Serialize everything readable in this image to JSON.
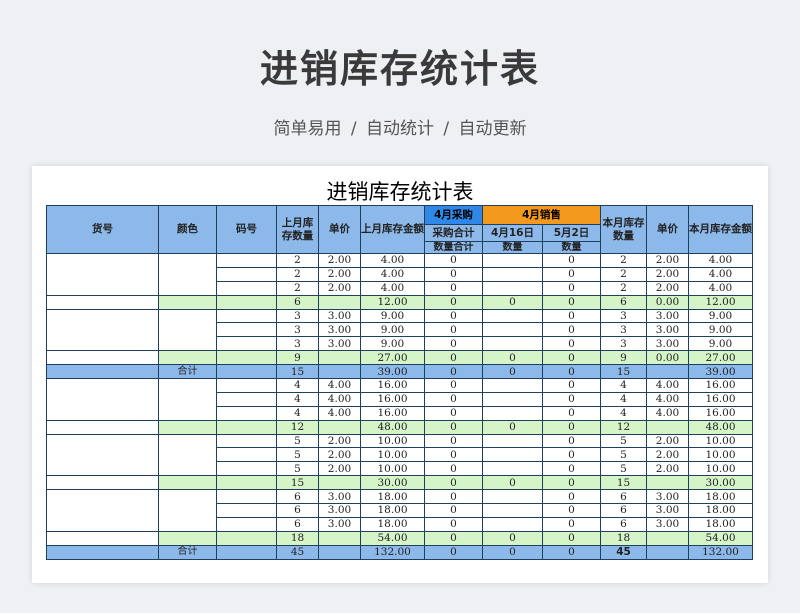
{
  "header": {
    "title": "进销库存统计表",
    "subtitle": "简单易用  /  自动统计  /  自动更新"
  },
  "sheet": {
    "title": "进销库存统计表",
    "columns": {
      "item_no": "货号",
      "color": "颜色",
      "code": "码号",
      "last_qty": "上月库存数量",
      "unit_price": "单价",
      "last_amount": "上月库存金额",
      "purchase_group": "4月采购",
      "sales_group": "4月销售",
      "purchase_total": "采购合计",
      "sale_date_1": "4月16日",
      "sale_date_2": "5月2日",
      "qty_total": "数量合计",
      "qty_1": "数量",
      "qty_2": "数量",
      "month_qty": "本月库存数量",
      "month_price": "单价",
      "month_amount": "本月库存金额"
    },
    "rows": [
      {
        "type": "item",
        "c": [
          "2",
          "2.00",
          "4.00",
          "0",
          "",
          "0",
          "2",
          "2.00",
          "4.00"
        ]
      },
      {
        "type": "item",
        "c": [
          "2",
          "2.00",
          "4.00",
          "0",
          "",
          "0",
          "2",
          "2.00",
          "4.00"
        ]
      },
      {
        "type": "item",
        "c": [
          "2",
          "2.00",
          "4.00",
          "0",
          "",
          "0",
          "2",
          "2.00",
          "4.00"
        ]
      },
      {
        "type": "subtotal",
        "c": [
          "6",
          "",
          "12.00",
          "0",
          "0",
          "0",
          "6",
          "0.00",
          "12.00"
        ]
      },
      {
        "type": "item",
        "c": [
          "3",
          "3.00",
          "9.00",
          "0",
          "",
          "0",
          "3",
          "3.00",
          "9.00"
        ]
      },
      {
        "type": "item",
        "c": [
          "3",
          "3.00",
          "9.00",
          "0",
          "",
          "0",
          "3",
          "3.00",
          "9.00"
        ]
      },
      {
        "type": "item",
        "c": [
          "3",
          "3.00",
          "9.00",
          "0",
          "",
          "0",
          "3",
          "3.00",
          "9.00"
        ]
      },
      {
        "type": "subtotal",
        "c": [
          "9",
          "",
          "27.00",
          "0",
          "0",
          "0",
          "9",
          "0.00",
          "27.00"
        ]
      },
      {
        "type": "total",
        "label": "合计",
        "c": [
          "15",
          "",
          "39.00",
          "0",
          "0",
          "0",
          "15",
          "",
          "39.00"
        ]
      },
      {
        "type": "item",
        "c": [
          "4",
          "4.00",
          "16.00",
          "0",
          "",
          "0",
          "4",
          "4.00",
          "16.00"
        ]
      },
      {
        "type": "item",
        "c": [
          "4",
          "4.00",
          "16.00",
          "0",
          "",
          "0",
          "4",
          "4.00",
          "16.00"
        ]
      },
      {
        "type": "item",
        "c": [
          "4",
          "4.00",
          "16.00",
          "0",
          "",
          "0",
          "4",
          "4.00",
          "16.00"
        ]
      },
      {
        "type": "subtotal",
        "c": [
          "12",
          "",
          "48.00",
          "0",
          "0",
          "0",
          "12",
          "",
          "48.00"
        ]
      },
      {
        "type": "item",
        "c": [
          "5",
          "2.00",
          "10.00",
          "0",
          "",
          "0",
          "5",
          "2.00",
          "10.00"
        ]
      },
      {
        "type": "item",
        "c": [
          "5",
          "2.00",
          "10.00",
          "0",
          "",
          "0",
          "5",
          "2.00",
          "10.00"
        ]
      },
      {
        "type": "item",
        "c": [
          "5",
          "2.00",
          "10.00",
          "0",
          "",
          "0",
          "5",
          "2.00",
          "10.00"
        ]
      },
      {
        "type": "subtotal",
        "c": [
          "15",
          "",
          "30.00",
          "0",
          "0",
          "0",
          "15",
          "",
          "30.00"
        ]
      },
      {
        "type": "item",
        "c": [
          "6",
          "3.00",
          "18.00",
          "0",
          "",
          "0",
          "6",
          "3.00",
          "18.00"
        ]
      },
      {
        "type": "item",
        "c": [
          "6",
          "3.00",
          "18.00",
          "0",
          "",
          "0",
          "6",
          "3.00",
          "18.00"
        ]
      },
      {
        "type": "item",
        "c": [
          "6",
          "3.00",
          "18.00",
          "0",
          "",
          "0",
          "6",
          "3.00",
          "18.00"
        ]
      },
      {
        "type": "subtotal",
        "c": [
          "18",
          "",
          "54.00",
          "0",
          "0",
          "0",
          "18",
          "",
          "54.00"
        ]
      },
      {
        "type": "total",
        "label": "合计",
        "c": [
          "45",
          "",
          "132.00",
          "0",
          "0",
          "0",
          "45",
          "",
          "132.00"
        ],
        "bold_month_qty": true
      }
    ]
  }
}
